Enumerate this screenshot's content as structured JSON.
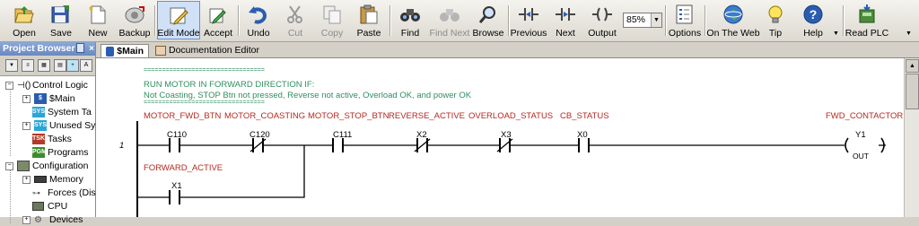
{
  "toolbar": {
    "buttons": [
      {
        "label": "Open",
        "icon": "open-folder-icon",
        "state": "normal"
      },
      {
        "label": "Save",
        "icon": "save-disk-icon",
        "state": "normal"
      },
      {
        "label": "New",
        "icon": "new-document-icon",
        "state": "normal"
      },
      {
        "label": "Backup",
        "icon": "backup-drive-icon",
        "state": "normal"
      },
      {
        "label": "Edit Mode",
        "icon": "edit-mode-icon",
        "state": "active"
      },
      {
        "label": "Accept",
        "icon": "accept-pencil-icon",
        "state": "normal"
      },
      {
        "label": "Undo",
        "icon": "undo-arrow-icon",
        "state": "normal"
      },
      {
        "label": "Cut",
        "icon": "scissors-icon",
        "state": "disabled"
      },
      {
        "label": "Copy",
        "icon": "copy-icon",
        "state": "disabled"
      },
      {
        "label": "Paste",
        "icon": "paste-clipboard-icon",
        "state": "normal"
      },
      {
        "label": "Find",
        "icon": "binoculars-icon",
        "state": "normal"
      },
      {
        "label": "Find Next",
        "icon": "binoculars-next-icon",
        "state": "disabled"
      },
      {
        "label": "Browse",
        "icon": "magnifier-icon",
        "state": "normal"
      },
      {
        "label": "Previous",
        "icon": "previous-contact-icon",
        "state": "normal"
      },
      {
        "label": "Next",
        "icon": "next-contact-icon",
        "state": "normal"
      },
      {
        "label": "Output",
        "icon": "output-coil-icon",
        "state": "normal"
      },
      {
        "label": "Options",
        "icon": "options-checklist-icon",
        "state": "normal"
      },
      {
        "label": "On The Web",
        "icon": "globe-icon",
        "state": "normal"
      },
      {
        "label": "Tip",
        "icon": "tip-bulb-icon",
        "state": "normal"
      },
      {
        "label": "Help",
        "icon": "help-question-icon",
        "state": "normal"
      },
      {
        "label": "Read PLC",
        "icon": "read-plc-icon",
        "state": "normal"
      }
    ],
    "zoom": "85%"
  },
  "project_browser": {
    "title": "Project Browser",
    "pin": "ᵖ",
    "close": "×",
    "items": [
      {
        "label": "Control Logic",
        "expander": "−"
      },
      {
        "label": "$Main",
        "expander": "+",
        "badge": "$"
      },
      {
        "label": "System Ta",
        "expander": "",
        "badge": "SYS"
      },
      {
        "label": "Unused Sy",
        "expander": "+",
        "badge": "SYS"
      },
      {
        "label": "Tasks",
        "expander": "",
        "badge": "TSK"
      },
      {
        "label": "Programs",
        "expander": "",
        "badge": "PGM"
      },
      {
        "label": "Configuration",
        "expander": "−"
      },
      {
        "label": "Memory",
        "expander": "+"
      },
      {
        "label": "Forces (Dis",
        "expander": ""
      },
      {
        "label": "CPU",
        "expander": ""
      },
      {
        "label": "Devices",
        "expander": "+"
      }
    ]
  },
  "tabs": [
    {
      "label": "$Main",
      "active": true
    },
    {
      "label": "Documentation Editor",
      "active": false
    }
  ],
  "ladder": {
    "rung_number": "1",
    "comment_lines": [
      "=================================",
      "RUN MOTOR IN FORWARD DIRECTION IF:",
      "Not Coasting, STOP Btn not pressed, Reverse not active, Overload OK, and power OK",
      "================================="
    ],
    "nicknames": [
      "MOTOR_FWD_BTN",
      "MOTOR_COASTING",
      "MOTOR_STOP_BTN",
      "REVERSE_ACTIVE",
      "OVERLOAD_STATUS",
      "CB_STATUS"
    ],
    "contacts": [
      {
        "address": "C110",
        "type": "NO"
      },
      {
        "address": "C120",
        "type": "NC"
      },
      {
        "address": "C111",
        "type": "NO"
      },
      {
        "address": "X2",
        "type": "NC"
      },
      {
        "address": "X3",
        "type": "NC"
      },
      {
        "address": "X0",
        "type": "NO"
      }
    ],
    "branch": {
      "nickname": "FORWARD_ACTIVE",
      "address": "X1"
    },
    "coil": {
      "nickname": "FWD_CONTACTOR",
      "address": "Y1",
      "instruction": "OUT"
    }
  },
  "colors": {
    "comment": "#2f8f5f",
    "nickname": "#b42a20",
    "rails": "#000000",
    "active_button": "#cfe0f7"
  }
}
